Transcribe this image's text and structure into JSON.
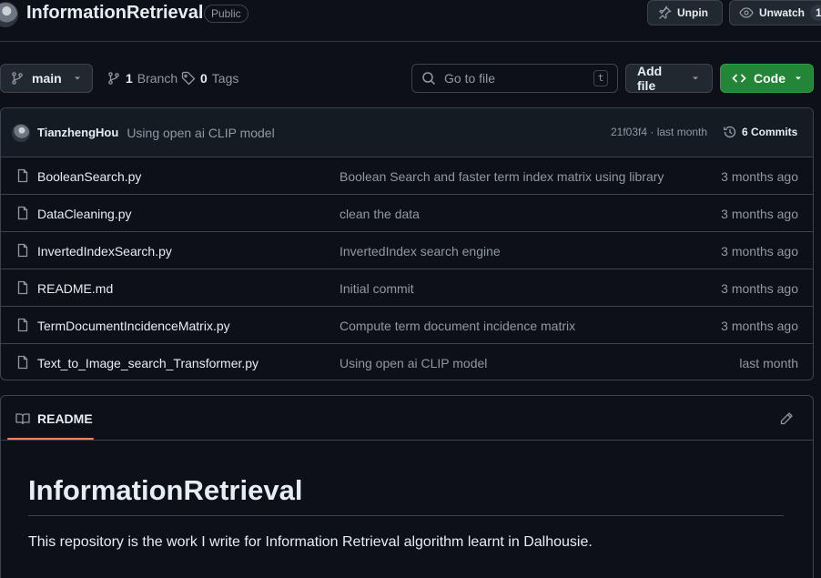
{
  "repo": {
    "name": "InformationRetrieval",
    "visibility": "Public"
  },
  "header_actions": {
    "unpin_label": "Unpin",
    "unwatch_label": "Unwatch",
    "watch_count": "1"
  },
  "toolbar": {
    "branch": "main",
    "branch_count": "1",
    "branch_label": "Branch",
    "tag_count": "0",
    "tag_label": "Tags",
    "search_placeholder": "Go to file",
    "search_shortcut": "t",
    "add_file_label": "Add file",
    "code_label": "Code"
  },
  "latest_commit": {
    "author": "TianzhengHou",
    "message": "Using open ai CLIP model",
    "meta": "21f03f4 · last month",
    "commits_label": "6 Commits"
  },
  "files": [
    {
      "name": "BooleanSearch.py",
      "message": "Boolean Search and faster term index matrix using library",
      "date": "3 months ago"
    },
    {
      "name": "DataCleaning.py",
      "message": "clean the data",
      "date": "3 months ago"
    },
    {
      "name": "InvertedIndexSearch.py",
      "message": "InvertedIndex search engine",
      "date": "3 months ago"
    },
    {
      "name": "README.md",
      "message": "Initial commit",
      "date": "3 months ago"
    },
    {
      "name": "TermDocumentIncidenceMatrix.py",
      "message": "Compute term document incidence matrix",
      "date": "3 months ago"
    },
    {
      "name": "Text_to_Image_search_Transformer.py",
      "message": "Using open ai CLIP model",
      "date": "last month"
    }
  ],
  "readme": {
    "tab_label": "README",
    "heading": "InformationRetrieval",
    "paragraph": "This repository is the work I write for Information Retrieval algorithm learnt in Dalhousie."
  },
  "colors": {
    "background": "#0d1117",
    "border": "#3d444d",
    "code_button": "#238636",
    "readme_tab_accent": "#f78166"
  }
}
